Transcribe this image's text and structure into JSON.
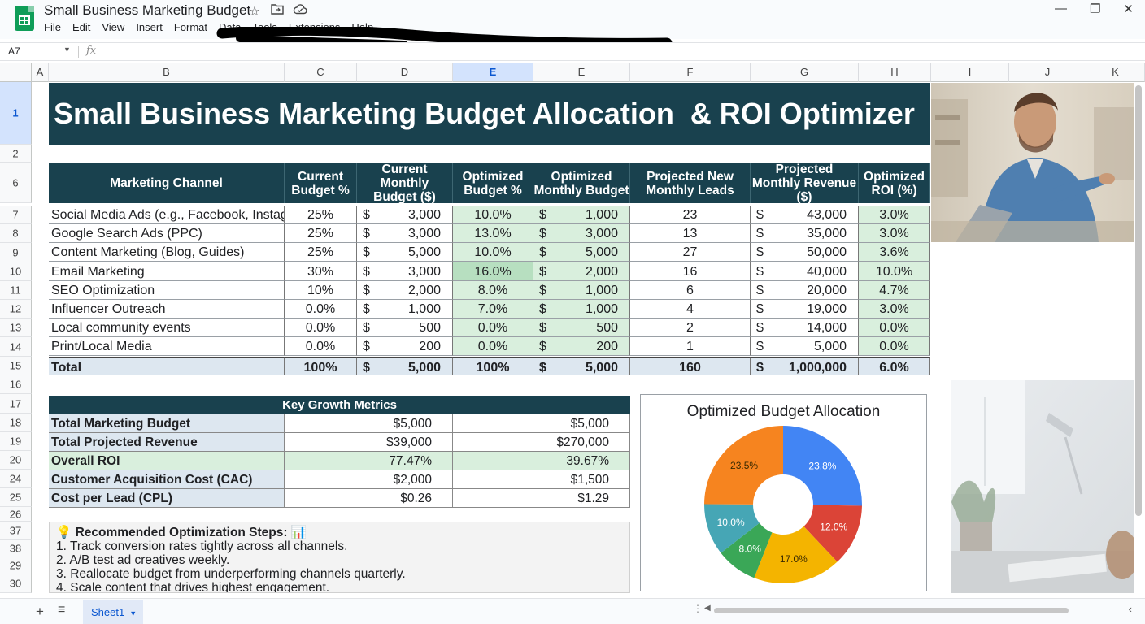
{
  "app": {
    "doc_title": "Small Business Marketing Budget",
    "menu": [
      "File",
      "Edit",
      "View",
      "Insert",
      "Format",
      "Data",
      "Tools",
      "Extensions",
      "Help"
    ],
    "window_controls": [
      "minimize-icon",
      "restore-icon",
      "close-icon"
    ],
    "title_icons": [
      "star-icon",
      "folder-icon",
      "cloud-icon"
    ]
  },
  "formula_bar": {
    "name_box": "A7",
    "fx_label": "fx",
    "formula": ""
  },
  "grid": {
    "columns": [
      "A",
      "B",
      "C",
      "D",
      "E",
      "E",
      "F",
      "G",
      "H",
      "I",
      "J",
      "K"
    ],
    "rows": [
      "1",
      "2",
      "6",
      "7",
      "8",
      "9",
      "10",
      "11",
      "12",
      "13",
      "14",
      "15",
      "16",
      "17",
      "18",
      "19",
      "20",
      "24",
      "25",
      "26",
      "37",
      "38",
      "29",
      "30"
    ]
  },
  "banner": {
    "title": "Small Business Marketing Budget Allocation  & ROI Optimizer"
  },
  "table": {
    "headers": [
      "Marketing Channel",
      "Current Budget %",
      "Current Monthly Budget ($)",
      "Optimized Budget %",
      "Optimized Monthly Budget",
      "Projected New Monthly Leads",
      "Projected Monthly Revenue ($)",
      "Optimized ROI (%)"
    ],
    "currency_symbol": "$",
    "rows": [
      {
        "channel": "Social Media Ads (e.g., Facebook, Instagram)",
        "cur_pct": "25%",
        "cur_budget": "3,000",
        "opt_pct": "10.0%",
        "opt_budget": "1,000",
        "leads": "23",
        "revenue": "43,000",
        "roi": "3.0%"
      },
      {
        "channel": "Google Search Ads (PPC)",
        "cur_pct": "25%",
        "cur_budget": "3,000",
        "opt_pct": "13.0%",
        "opt_budget": "3,000",
        "leads": "13",
        "revenue": "35,000",
        "roi": "3.0%"
      },
      {
        "channel": "Content Marketing (Blog, Guides)",
        "cur_pct": "25%",
        "cur_budget": "5,000",
        "opt_pct": "10.0%",
        "opt_budget": "5,000",
        "leads": "27",
        "revenue": "50,000",
        "roi": "3.6%"
      },
      {
        "channel": "Email Marketing",
        "cur_pct": "30%",
        "cur_budget": "3,000",
        "opt_pct": "16.0%",
        "opt_budget": "2,000",
        "leads": "16",
        "revenue": "40,000",
        "roi": "10.0%"
      },
      {
        "channel": "SEO Optimization",
        "cur_pct": "10%",
        "cur_budget": "2,000",
        "opt_pct": "8.0%",
        "opt_budget": "1,000",
        "leads": "6",
        "revenue": "20,000",
        "roi": "4.7%"
      },
      {
        "channel": "Influencer Outreach",
        "cur_pct": "0.0%",
        "cur_budget": "1,000",
        "opt_pct": "7.0%",
        "opt_budget": "1,000",
        "leads": "4",
        "revenue": "19,000",
        "roi": "3.0%"
      },
      {
        "channel": "Local community events",
        "cur_pct": "0.0%",
        "cur_budget": "500",
        "opt_pct": "0.0%",
        "opt_budget": "500",
        "leads": "2",
        "revenue": "14,000",
        "roi": "0.0%"
      },
      {
        "channel": "Print/Local Media",
        "cur_pct": "0.0%",
        "cur_budget": "200",
        "opt_pct": "0.0%",
        "opt_budget": "200",
        "leads": "1",
        "revenue": "5,000",
        "roi": "0.0%"
      }
    ],
    "total": {
      "channel": "Total",
      "cur_pct": "100%",
      "cur_budget": "5,000",
      "opt_pct": "100%",
      "opt_budget": "5,000",
      "leads": "160",
      "revenue": "1,000,000",
      "roi": "6.0%"
    }
  },
  "metrics": {
    "title": "Key Growth Metrics",
    "rows": [
      {
        "label": "Total Marketing Budget",
        "v1": "$5,000",
        "v2": "$5,000"
      },
      {
        "label": "Total Projected Revenue",
        "v1": "$39,000",
        "v2": "$270,000"
      },
      {
        "label": "Overall ROI",
        "v1": "77.47%",
        "v2": "39.67%"
      },
      {
        "label": "Customer Acquisition Cost (CAC)",
        "v1": "$2,000",
        "v2": "$1,500"
      },
      {
        "label": "Cost per Lead (CPL)",
        "v1": "$0.26",
        "v2": "$1.29"
      }
    ]
  },
  "recommendations": {
    "title": "💡 Recommended Optimization Steps: 📊",
    "steps": [
      "1. Track conversion rates tightly across all channels.",
      "2. A/B test ad creatives weekly.",
      "3. Reallocate budget from underperforming channels quarterly.",
      "4. Scale content that drives highest engagement."
    ]
  },
  "chart_data": {
    "type": "pie",
    "title": "Optimized Budget Allocation",
    "donut": true,
    "slices": [
      {
        "label": "23.8%",
        "value": 23.8,
        "color": "#4285f4"
      },
      {
        "label": "12.0%",
        "value": 12.0,
        "color": "#db4437"
      },
      {
        "label": "17.0%",
        "value": 17.0,
        "color": "#f4b400"
      },
      {
        "label": "8.0%",
        "value": 8.0,
        "color": "#3aa757"
      },
      {
        "label": "10.0%",
        "value": 10.0,
        "color": "#46a6b5"
      },
      {
        "label": "23.5%",
        "value": 23.5,
        "color": "#f6841f"
      }
    ]
  },
  "bottom": {
    "sheet_name": "Sheet1"
  },
  "colors": {
    "header_dark": "#19414e",
    "green_fill": "#d9efdd",
    "blue_fill": "#dde7f0",
    "sheets_green": "#0f9d58"
  }
}
